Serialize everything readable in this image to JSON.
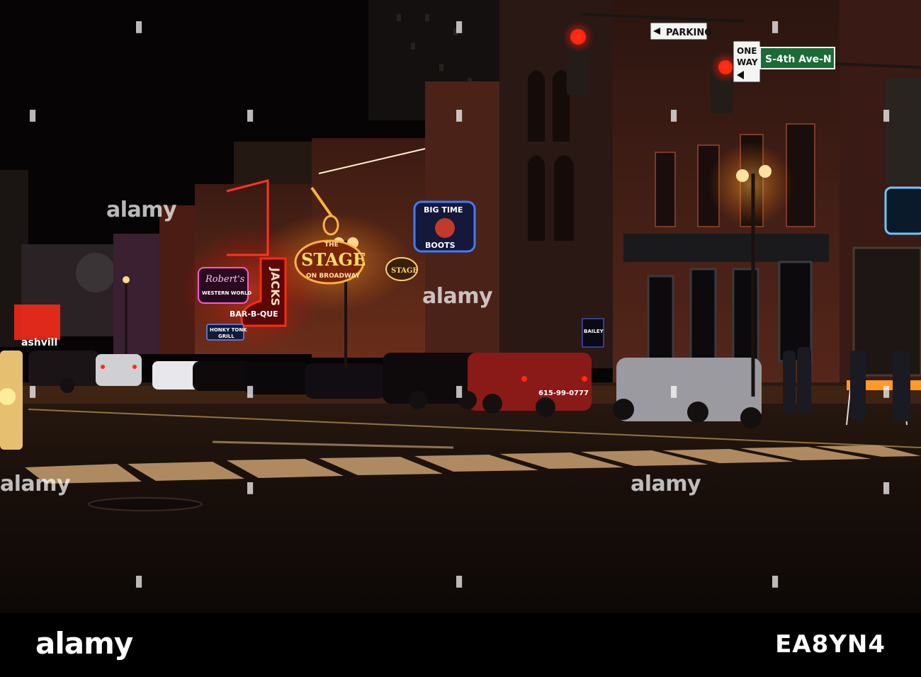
{
  "scene": {
    "signs": {
      "parking": "PARKING",
      "one_way_top": "ONE",
      "one_way_bottom": "WAY",
      "street": "S-4th Ave-N",
      "the": "THE",
      "stage": "STAGE",
      "stage_sub": "ON BROADWAY",
      "stage_small": "STAGE",
      "big_time": "BIG TIME",
      "boots": "BOOTS",
      "roberts": "Robert's",
      "roberts_sub": "WESTERN WORLD",
      "jacks": "JACKS",
      "barbque": "BAR-B-QUE",
      "honky_tonk": "HONKY TONK",
      "honky_grill": "GRILL",
      "nashville": "ashvill",
      "barleys": "BAILEY",
      "taxi_phone": "615-99-0777"
    }
  },
  "watermark": {
    "text": "alamy"
  },
  "footer": {
    "logo": "alamy",
    "image_id": "EA8YN4"
  },
  "colors": {
    "neon_red": "#ff3320",
    "neon_orange": "#ffb040",
    "neon_blue": "#3f7bff",
    "traffic_red": "#ff2a10"
  }
}
